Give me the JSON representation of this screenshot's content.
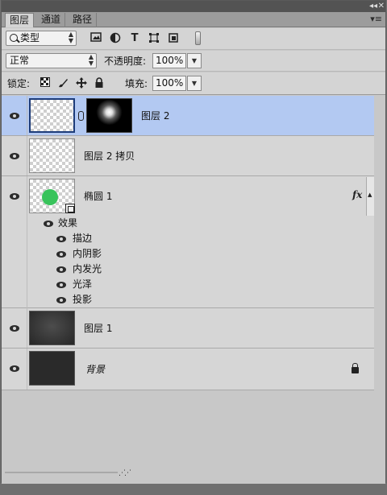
{
  "titlebar": {
    "collapse_glyph": "◂◂",
    "close_glyph": "✕"
  },
  "tabs": [
    {
      "label": "图层",
      "active": true
    },
    {
      "label": "通道",
      "active": false
    },
    {
      "label": "路径",
      "active": false
    }
  ],
  "tab_menu_glyph": "▾≡",
  "filter": {
    "kind_label": "类型",
    "icons": [
      "image-filter-icon",
      "adjustment-filter-icon",
      "type-filter-icon",
      "shape-filter-icon",
      "smart-object-filter-icon"
    ],
    "type_glyph": "T"
  },
  "blend": {
    "mode": "正常",
    "opacity_label": "不透明度:",
    "opacity": "100%"
  },
  "lock": {
    "label": "锁定:",
    "fill_label": "填充:",
    "fill": "100%"
  },
  "layers": [
    {
      "name": "图层 2",
      "selected": true,
      "has_mask": true
    },
    {
      "name": "图层 2 拷贝",
      "selected": false
    },
    {
      "name": "椭圆 1",
      "selected": false,
      "fx_label": "fx",
      "effects_label": "效果",
      "effects": [
        "描边",
        "内阴影",
        "内发光",
        "光泽",
        "投影"
      ]
    },
    {
      "name": "图层 1",
      "selected": false
    },
    {
      "name": "背景",
      "selected": false,
      "locked": true
    }
  ],
  "colors": {
    "selected_row": "#b3c9f2",
    "ellipse_fill": "#38c35b",
    "panel_bg": "#d6d6d6"
  }
}
